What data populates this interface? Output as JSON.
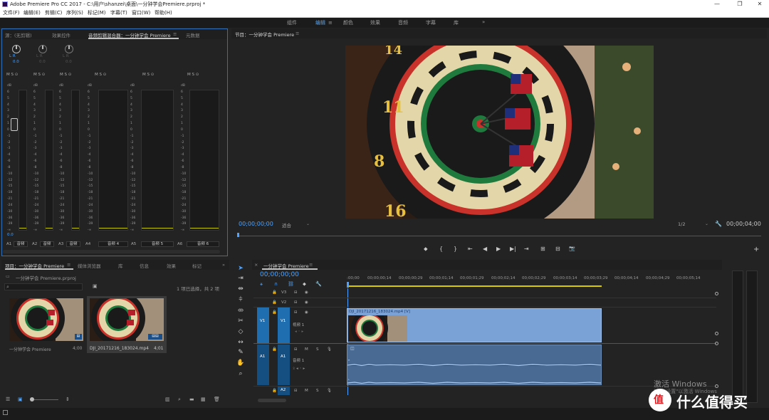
{
  "titlebar": {
    "title": "Adobe Premiere Pro CC 2017 - C:\\用户\\shanzei\\桌面\\一分钟学会Premiere.prproj *",
    "minimize": "—",
    "maximize": "❐",
    "close": "✕"
  },
  "menu": [
    "文件(F)",
    "编辑(E)",
    "剪辑(C)",
    "序列(S)",
    "标记(M)",
    "字幕(T)",
    "窗口(W)",
    "帮助(H)"
  ],
  "workspaces": {
    "items": [
      "组件",
      "编辑",
      "颜色",
      "效果",
      "音频",
      "字幕",
      "库"
    ],
    "active": "编辑",
    "more": "»"
  },
  "left_panel": {
    "tabs": [
      "源：(无剪辑)",
      "效果控件",
      "音频剪辑混合器：一分钟学会 Premiere",
      "元数据"
    ],
    "active_tab": "音频剪辑混合器：一分钟学会 Premiere",
    "menu_icon": "≡",
    "channels": [
      {
        "id": "A1",
        "lr": "L   R",
        "value": "0.0",
        "name": "音频"
      },
      {
        "id": "A2",
        "lr": "L   R",
        "value": "0.0",
        "name": "音频"
      },
      {
        "id": "A3",
        "lr": "L   R",
        "value": "0.0",
        "name": "音频"
      },
      {
        "id": "A4",
        "lr": "",
        "value": "",
        "name": "音频 4"
      },
      {
        "id": "A5",
        "lr": "",
        "value": "",
        "name": "音频 5"
      },
      {
        "id": "A6",
        "lr": "",
        "value": "",
        "name": "音频 6"
      }
    ],
    "msr": "M  S  ⊙",
    "db_scale": [
      "dB",
      "6",
      "5",
      "4",
      "3",
      "2",
      "1",
      "0",
      "-1",
      "-2",
      "-3",
      "-4",
      "-6",
      "-8",
      "-10",
      "-12",
      "-15",
      "-18",
      "-21",
      "-24",
      "-30",
      "-36",
      "-39",
      "-∞"
    ],
    "fader_value": "0.0"
  },
  "program_monitor": {
    "title": "节目：一分钟学会 Premiere",
    "menu_icon": "≡",
    "timecode_current": "00;00;00;00",
    "fit": "适合",
    "resolution": "1/2",
    "timecode_end": "00;00;04;00",
    "controls": [
      "⬥",
      "{",
      "}",
      "⇤",
      "◀",
      "▶",
      "▶|",
      "⇥",
      "⊞",
      "⊟",
      "📷"
    ],
    "add": "+"
  },
  "project_panel": {
    "tabs": [
      "项目：一分钟学会 Premiere",
      "媒体浏览器",
      "库",
      "信息",
      "效果",
      "标记"
    ],
    "active_tab": "项目：一分钟学会 Premiere",
    "more": "»",
    "path": "一分钟学会 Premiere.prproj",
    "search_placeholder": "",
    "selection_info": "1 项已选择，共 2 项",
    "items": [
      {
        "name": "一分钟学会 Premiere",
        "duration": "4;00"
      },
      {
        "name": "DJI_20171216_183024.mp4",
        "duration": "4;01"
      }
    ]
  },
  "timeline": {
    "tab": "一分钟学会 Premiere",
    "menu_icon": "≡",
    "close": "×",
    "timecode": "00;00;00;00",
    "ruler": [
      ":00;00",
      "00;00;00;14",
      "00;00;00;29",
      "00;00;01;14",
      "00;00;01;29",
      "00;00;02;14",
      "00;00;02;29",
      "00;00;03;14",
      "00;00;03;29",
      "00;00;04;14",
      "00;00;04;29",
      "00;00;05;14"
    ],
    "tracks": {
      "v3": "V3",
      "v2": "V2",
      "v1": "V1",
      "v1_src": "V1",
      "v1_name": "视频 1",
      "a1": "A1",
      "a1_src": "A1",
      "a1_name": "音频 1",
      "a2": "A2"
    },
    "video_clip": "DJI_20171216_183024.mp4 [V]"
  },
  "watermark": {
    "activate": "激活 Windows",
    "activate_sub": "转到\"设置\"以激活 Windows",
    "brand": "什么值得买"
  },
  "colors": {
    "accent_blue": "#4da3ff",
    "track_blue": "#1f6fb0",
    "clip_video": "#7ba2d6",
    "clip_audio": "#486a93",
    "vu": "#c8c800"
  }
}
